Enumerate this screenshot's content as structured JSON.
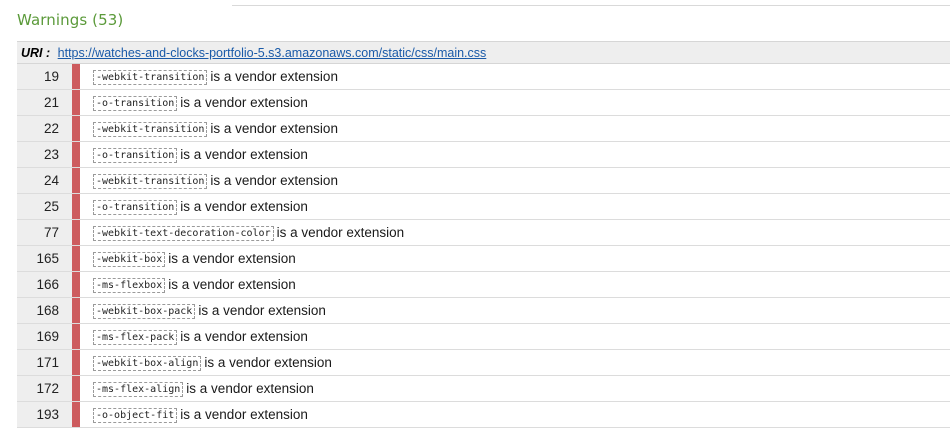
{
  "heading": "Warnings (53)",
  "uri": {
    "label": "URI :",
    "url": "https://watches-and-clocks-portfolio-5.s3.amazonaws.com/static/css/main.css"
  },
  "rows": [
    {
      "line": "19",
      "property": "-webkit-transition",
      "message": "is a vendor extension"
    },
    {
      "line": "21",
      "property": "-o-transition",
      "message": "is a vendor extension"
    },
    {
      "line": "22",
      "property": "-webkit-transition",
      "message": "is a vendor extension"
    },
    {
      "line": "23",
      "property": "-o-transition",
      "message": "is a vendor extension"
    },
    {
      "line": "24",
      "property": "-webkit-transition",
      "message": "is a vendor extension"
    },
    {
      "line": "25",
      "property": "-o-transition",
      "message": "is a vendor extension"
    },
    {
      "line": "77",
      "property": "-webkit-text-decoration-color",
      "message": "is a vendor extension"
    },
    {
      "line": "165",
      "property": "-webkit-box",
      "message": "is a vendor extension"
    },
    {
      "line": "166",
      "property": "-ms-flexbox",
      "message": "is a vendor extension"
    },
    {
      "line": "168",
      "property": "-webkit-box-pack",
      "message": "is a vendor extension"
    },
    {
      "line": "169",
      "property": "-ms-flex-pack",
      "message": "is a vendor extension"
    },
    {
      "line": "171",
      "property": "-webkit-box-align",
      "message": "is a vendor extension"
    },
    {
      "line": "172",
      "property": "-ms-flex-align",
      "message": "is a vendor extension"
    },
    {
      "line": "193",
      "property": "-o-object-fit",
      "message": "is a vendor extension"
    }
  ],
  "colors": {
    "heading": "#5b9a3a",
    "marker": "#cd5b5e",
    "link": "#1a5aa8"
  }
}
